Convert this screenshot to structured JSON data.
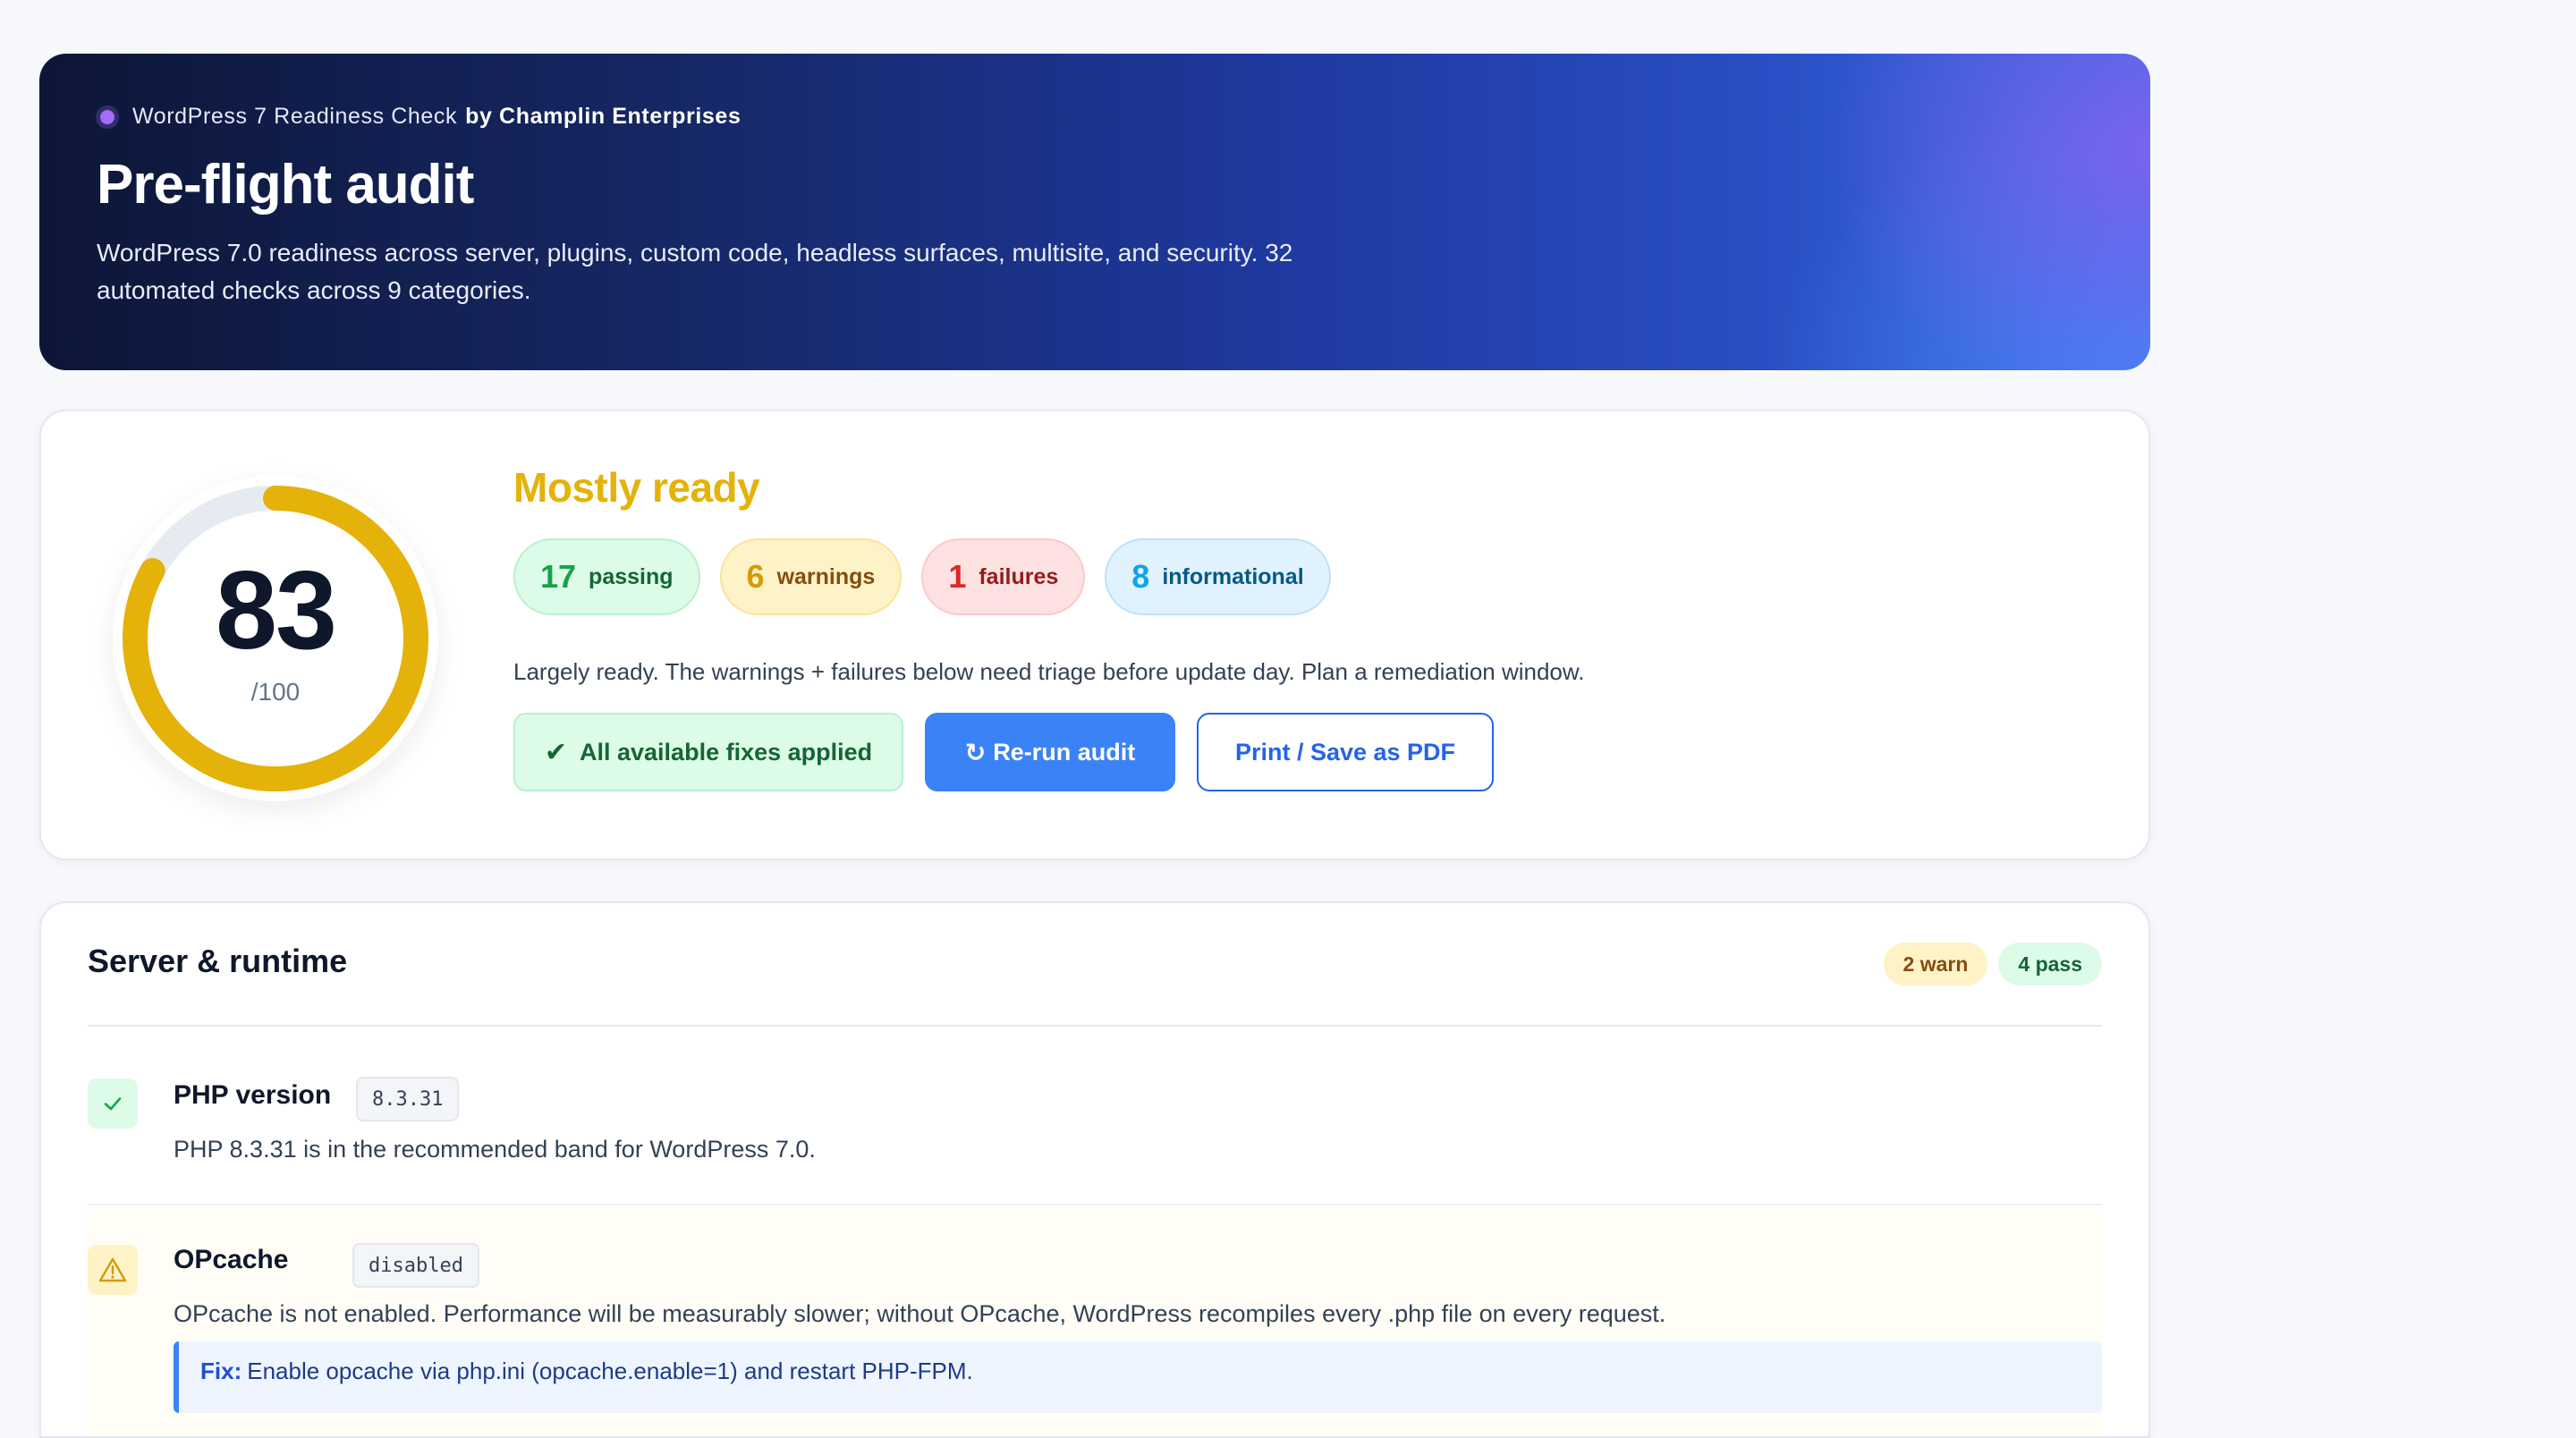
{
  "hero": {
    "eyebrow": "WordPress 7 Readiness Check",
    "by": "by Champlin Enterprises",
    "title": "Pre-flight audit",
    "subtitle": "WordPress 7.0 readiness across server, plugins, custom code, headless surfaces, multisite, and security. 32 automated checks across 9 categories."
  },
  "score": {
    "value": "83",
    "out_of": "/100",
    "fraction": 0.83,
    "ring_color": "#e5b20a",
    "verdict": "Mostly ready",
    "counts": [
      {
        "number": "17",
        "label": "passing",
        "kind": "pass"
      },
      {
        "number": "6",
        "label": "warnings",
        "kind": "warn"
      },
      {
        "number": "1",
        "label": "failures",
        "kind": "fail"
      },
      {
        "number": "8",
        "label": "informational",
        "kind": "info"
      }
    ],
    "note": "Largely ready. The warnings + failures below need triage before update day. Plan a remediation window.",
    "buttons": {
      "applied": "All available fixes applied",
      "applied_icon": "check-icon",
      "rerun": "Re-run audit",
      "rerun_icon": "refresh-icon",
      "print": "Print / Save as PDF"
    }
  },
  "section": {
    "title": "Server & runtime",
    "badges": [
      "2 warn",
      "4 pass"
    ],
    "checks": [
      {
        "status": "pass",
        "status_icon": "check-icon",
        "name": "PHP version",
        "value": "8.3.31",
        "description": "PHP 8.3.31 is in the recommended band for WordPress 7.0."
      },
      {
        "status": "warn",
        "status_icon": "warning-icon",
        "name": "OPcache",
        "value": "disabled",
        "description": "OPcache is not enabled. Performance will be measurably slower; without OPcache, WordPress recompiles every .php file on every request.",
        "fix_label": "Fix:",
        "fix_text": "Enable opcache via php.ini (opcache.enable=1) and restart PHP-FPM."
      }
    ]
  }
}
